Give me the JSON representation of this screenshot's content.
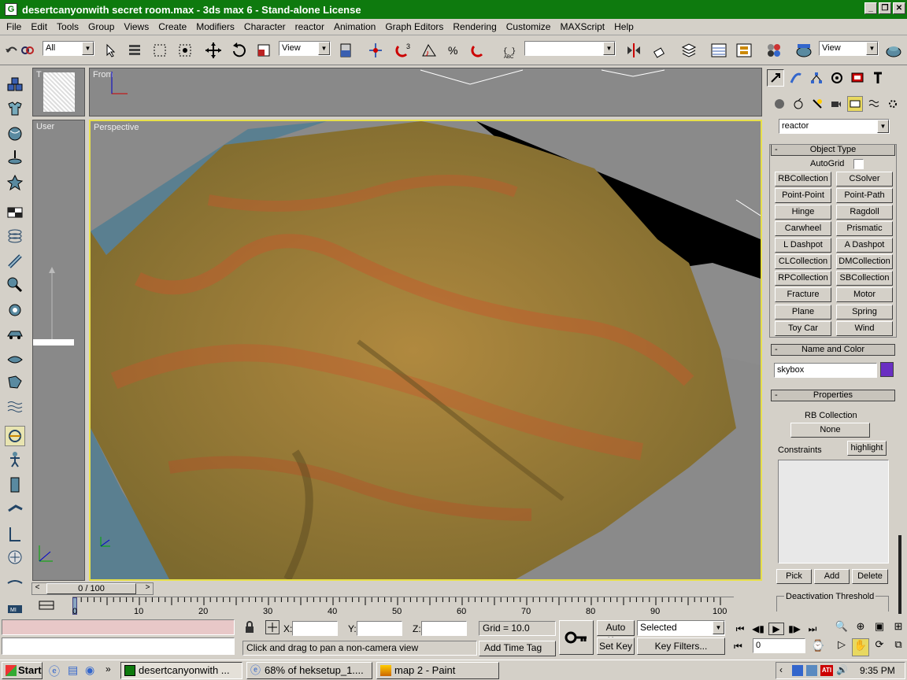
{
  "window": {
    "title": "desertcanyonwith secret room.max - 3ds max 6 - Stand-alone License"
  },
  "menu": [
    "File",
    "Edit",
    "Tools",
    "Group",
    "Views",
    "Create",
    "Modifiers",
    "Character",
    "reactor",
    "Animation",
    "Graph Editors",
    "Rendering",
    "Customize",
    "MAXScript",
    "Help"
  ],
  "toolbar": {
    "selection_filter": "All",
    "ref_coord": "View",
    "named_sel": "",
    "render_view": "View"
  },
  "viewports": {
    "top": "T",
    "front": "From",
    "user": "User",
    "perspective": "Perspective"
  },
  "command_panel": {
    "category": "reactor",
    "object_type": {
      "header": "Object Type",
      "autogrid": "AutoGrid",
      "buttons": [
        "RBCollection",
        "CSolver",
        "Point-Point",
        "Point-Path",
        "Hinge",
        "Ragdoll",
        "Carwheel",
        "Prismatic",
        "L Dashpot",
        "A Dashpot",
        "CLCollection",
        "DMCollection",
        "RPCollection",
        "SBCollection",
        "Fracture",
        "Motor",
        "Plane",
        "Spring",
        "Toy Car",
        "Wind"
      ]
    },
    "name_color": {
      "header": "Name and Color",
      "name": "skybox",
      "color": "#6a2fc2"
    },
    "properties": {
      "header": "Properties",
      "rb_collection": "RB Collection",
      "rb_value": "None",
      "constraints": "Constraints",
      "highlight": "highlight",
      "pick": "Pick",
      "add": "Add",
      "delete": "Delete",
      "deactivation": "Deactivation Threshold"
    }
  },
  "timeline": {
    "frame": "0 / 100",
    "ticks": [
      "0",
      "10",
      "20",
      "30",
      "40",
      "50",
      "60",
      "70",
      "80",
      "90",
      "100"
    ]
  },
  "status": {
    "x_label": "X:",
    "y_label": "Y:",
    "z_label": "Z:",
    "grid": "Grid = 10.0",
    "prompt": "Click and drag to pan a non-camera view",
    "add_time_tag": "Add Time Tag",
    "auto_key": "Auto Key",
    "set_key": "Set Key",
    "selected": "Selected",
    "key_filters": "Key Filters...",
    "frame_field": "0"
  },
  "taskbar": {
    "start": "Start",
    "tasks": [
      "desertcanyonwith ...",
      "68% of heksetup_1....",
      "map 2 - Paint"
    ],
    "clock": "9:35 PM"
  }
}
